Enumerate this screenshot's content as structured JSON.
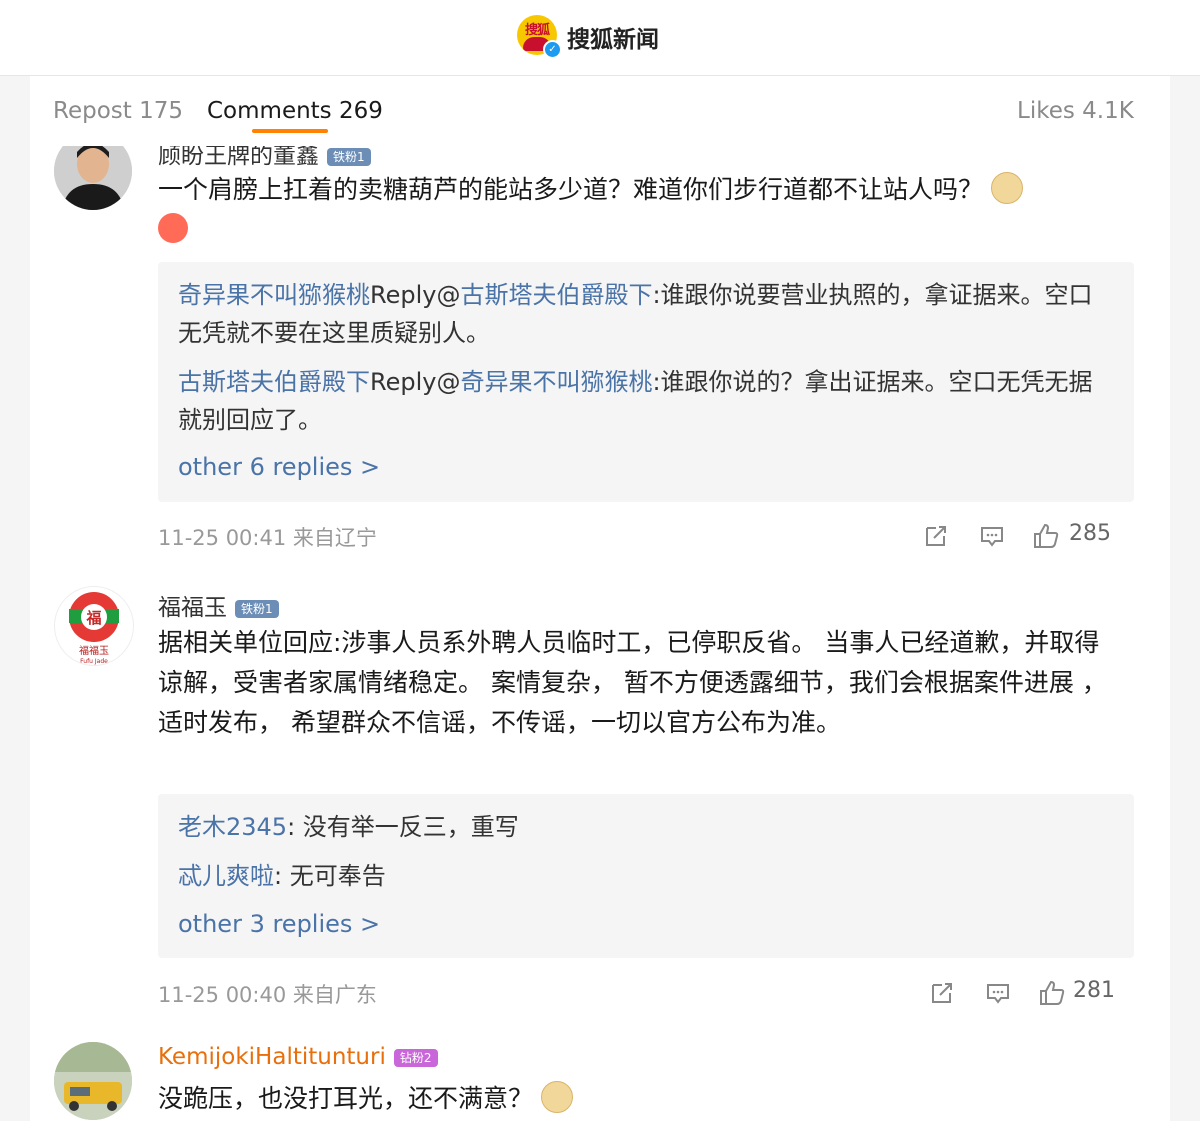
{
  "header": {
    "logo_text": "搜狐",
    "title": "搜狐新闻"
  },
  "tabs": {
    "repost": "Repost 175",
    "comments": "Comments 269",
    "likes": "Likes 4.1K"
  },
  "comments": [
    {
      "username": "顾盼王牌的董鑫",
      "badge": "铁粉1",
      "text": "一个肩膀上扛着的卖糖葫芦的能站多少道？难道你们步行道都不让站人吗？",
      "emojis": [
        "doge-icon",
        "angry-icon"
      ],
      "replies": [
        {
          "name": "奇异果不叫猕猴桃",
          "reply_word": "Reply@",
          "target": "古斯塔夫伯爵殿下",
          "text": ":谁跟你说要营业执照的，拿证据来。空口无凭就不要在这里质疑别人。"
        },
        {
          "name": "古斯塔夫伯爵殿下",
          "reply_word": "Reply@",
          "target": "奇异果不叫猕猴桃",
          "text": ":谁跟你说的？拿出证据来。空口无凭无据就别回应了。"
        }
      ],
      "more_replies": "other 6 replies >",
      "meta": "11-25 00:41 来自辽宁",
      "likes": "285"
    },
    {
      "username": "福福玉",
      "badge": "铁粉1",
      "avatar_text": "福福玉",
      "avatar_sub": "Fufu Jade",
      "text": "据相关单位回应:涉事人员系外聘人员临时工，已停职反省。 当事人已经道歉，并取得谅解，受害者家属情绪稳定。 案情复杂， 暂不方便透露细节，我们会根据案件进展 ，适时发布， 希望群众不信谣，不传谣，一切以官方公布为准。",
      "replies": [
        {
          "name": "老木2345",
          "text": ": 没有举一反三，重写"
        },
        {
          "name": "忒儿爽啦",
          "text": ": 无可奉告"
        }
      ],
      "more_replies": "other 3 replies >",
      "meta": "11-25 00:40 来自广东",
      "likes": "281"
    },
    {
      "username": "KemijokiHaltitunturi",
      "badge": "钻粉2",
      "text": "没跪压，也没打耳光，还不满意？",
      "emojis": [
        "doge-icon"
      ]
    }
  ],
  "colors": {
    "accent": "#ff8200",
    "link": "#4a73a8",
    "username_orange": "#e86f0b"
  }
}
